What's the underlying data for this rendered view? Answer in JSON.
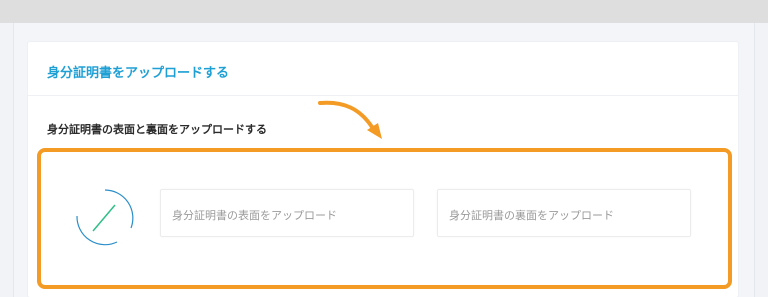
{
  "page": {
    "card_title": "身分証明書をアップロードする",
    "section_title": "身分証明書の表面と裏面をアップロードする"
  },
  "upload": {
    "front_label": "身分証明書の表面をアップロード",
    "back_label": "身分証明書の裏面をアップロード"
  },
  "colors": {
    "accent": "#1fa0d5",
    "highlight": "#f39b24",
    "spinner_line": "#2fbf87",
    "spinner_arc": "#2b8fc9"
  },
  "icons": {
    "loading": "loading-spinner-icon",
    "pointer": "curved-arrow-icon"
  }
}
